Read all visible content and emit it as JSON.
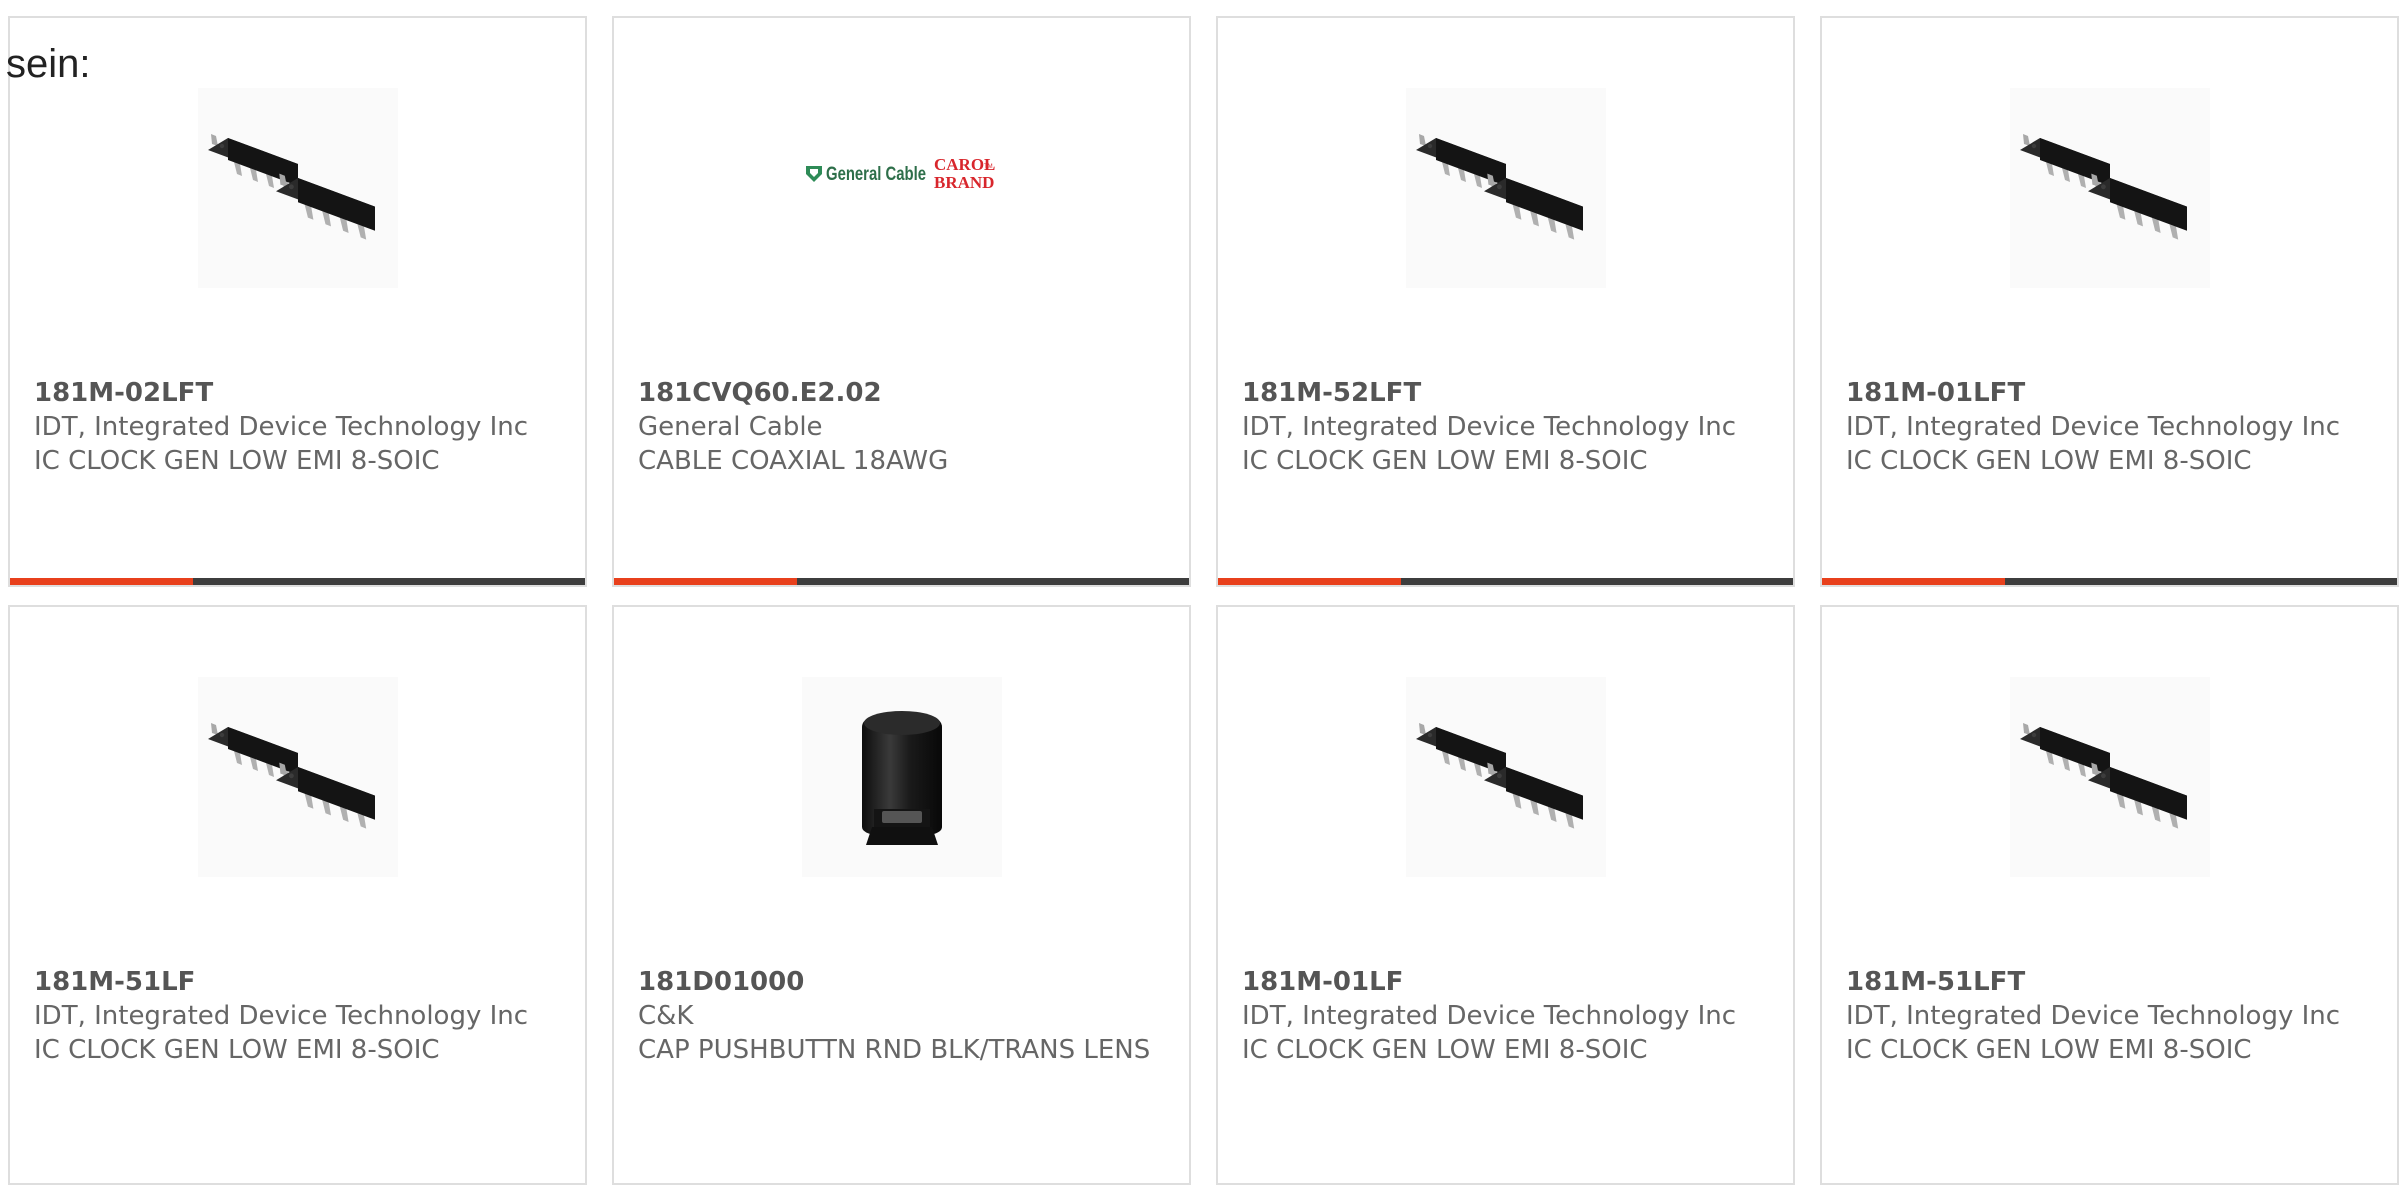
{
  "page": {
    "label": "sein:"
  },
  "colors": {
    "accent": "#e8401c",
    "bar": "#3d3d3d",
    "border": "#dedede",
    "text": "#666666"
  },
  "products": [
    {
      "part_number": "181M-02LFT",
      "manufacturer": "IDT, Integrated Device Technology Inc",
      "description": "IC CLOCK GEN LOW EMI 8-SOIC",
      "image": "soic-8-chip-icon"
    },
    {
      "part_number": "181CVQ60.E2.02",
      "manufacturer": "General Cable",
      "description": "CABLE COAXIAL 18AWG",
      "image": "general-cable-logo",
      "logo_text": "General Cable",
      "logo_brand_line1": "CAROL",
      "logo_brand_small": "TM",
      "logo_brand_line2": "BRAND"
    },
    {
      "part_number": "181M-52LFT",
      "manufacturer": "IDT, Integrated Device Technology Inc",
      "description": "IC CLOCK GEN LOW EMI 8-SOIC",
      "image": "soic-8-chip-icon"
    },
    {
      "part_number": "181M-01LFT",
      "manufacturer": "IDT, Integrated Device Technology Inc",
      "description": "IC CLOCK GEN LOW EMI 8-SOIC",
      "image": "soic-8-chip-icon"
    },
    {
      "part_number": "181M-51LF",
      "manufacturer": "IDT, Integrated Device Technology Inc",
      "description": "IC CLOCK GEN LOW EMI 8-SOIC",
      "image": "soic-8-chip-icon"
    },
    {
      "part_number": "181D01000",
      "manufacturer": "C&K",
      "description": "CAP PUSHBUTTN RND BLK/TRANS LENS",
      "image": "pushbutton-cap-icon"
    },
    {
      "part_number": "181M-01LF",
      "manufacturer": "IDT, Integrated Device Technology Inc",
      "description": "IC CLOCK GEN LOW EMI 8-SOIC",
      "image": "soic-8-chip-icon"
    },
    {
      "part_number": "181M-51LFT",
      "manufacturer": "IDT, Integrated Device Technology Inc",
      "description": "IC CLOCK GEN LOW EMI 8-SOIC",
      "image": "soic-8-chip-icon"
    }
  ]
}
